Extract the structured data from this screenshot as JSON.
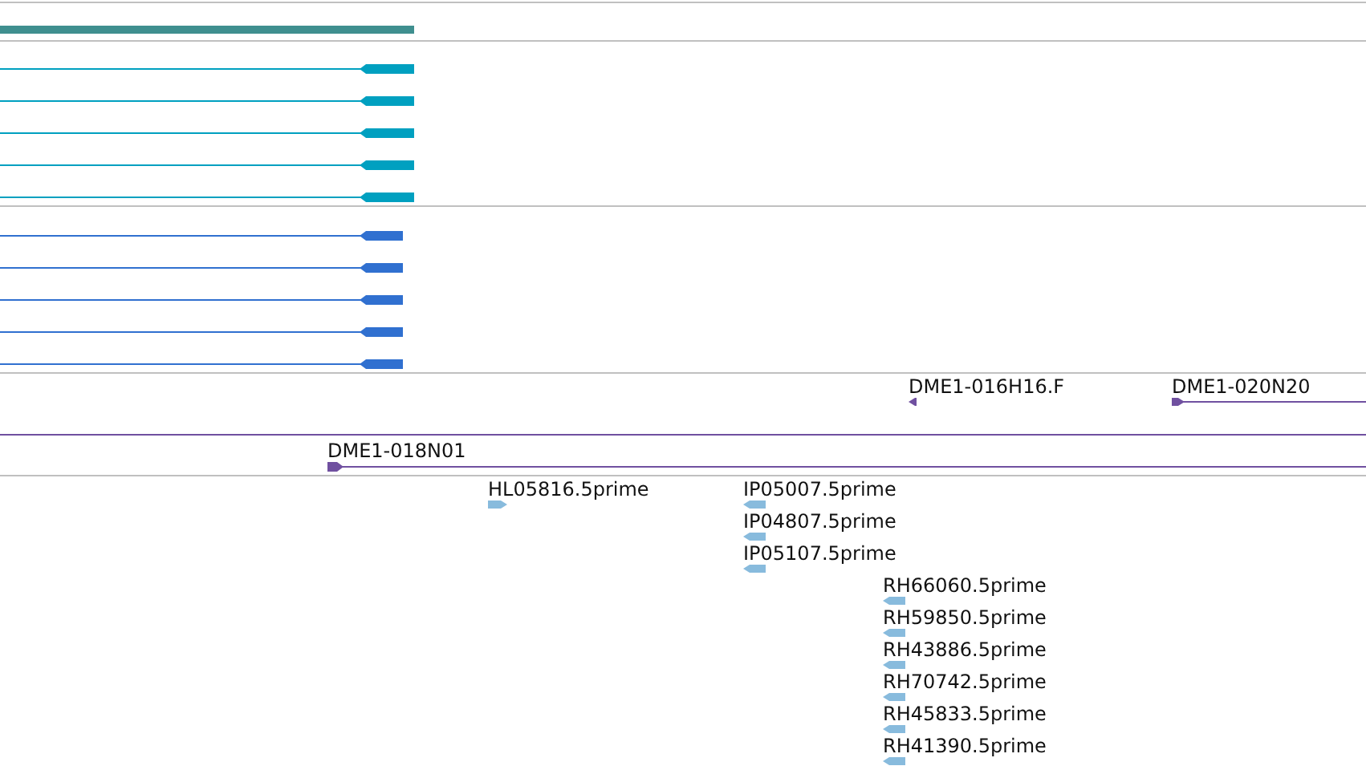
{
  "tracks": [
    {
      "color": "#3f8f8f",
      "features": [
        {
          "kind": "bar"
        }
      ]
    },
    {
      "color": "#00a0c0",
      "features": [
        {
          "kind": "reverse"
        },
        {
          "kind": "reverse"
        },
        {
          "kind": "reverse"
        },
        {
          "kind": "reverse"
        },
        {
          "kind": "reverse"
        }
      ]
    },
    {
      "color": "#3070d0",
      "features": [
        {
          "kind": "reverse"
        },
        {
          "kind": "reverse"
        },
        {
          "kind": "reverse"
        },
        {
          "kind": "reverse"
        },
        {
          "kind": "reverse"
        }
      ]
    },
    {
      "color": "#7050a0",
      "features": [
        {
          "kind": "reverse",
          "label": "DME1-016H16.F"
        },
        {
          "kind": "forward",
          "label": "DME1-020N20"
        },
        {
          "kind": "span"
        }
      ]
    },
    {
      "color": "#7050a0",
      "features": [
        {
          "kind": "forward",
          "label": "DME1-018N01"
        }
      ]
    },
    {
      "color": "#88bbdd",
      "features": [
        {
          "kind": "forward",
          "label": "HL05816.5prime"
        },
        {
          "kind": "reverse",
          "label": "IP05007.5prime"
        },
        {
          "kind": "reverse",
          "label": "IP04807.5prime"
        },
        {
          "kind": "reverse",
          "label": "IP05107.5prime"
        },
        {
          "kind": "reverse",
          "label": "RH66060.5prime"
        },
        {
          "kind": "reverse",
          "label": "RH59850.5prime"
        },
        {
          "kind": "reverse",
          "label": "RH43886.5prime"
        },
        {
          "kind": "reverse",
          "label": "RH70742.5prime"
        },
        {
          "kind": "reverse",
          "label": "RH45833.5prime"
        },
        {
          "kind": "reverse",
          "label": "RH41390.5prime"
        }
      ]
    }
  ]
}
